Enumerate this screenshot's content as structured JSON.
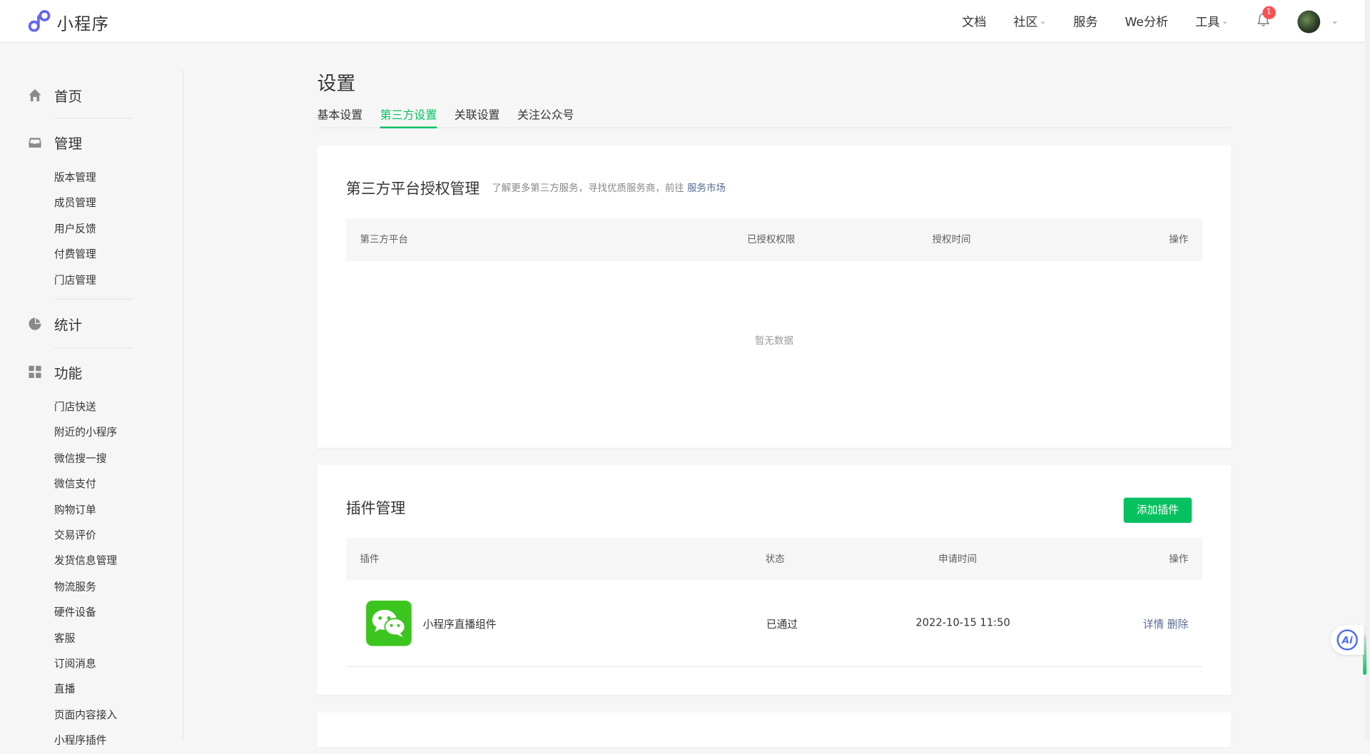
{
  "app": {
    "name": "小程序"
  },
  "topnav": {
    "items": [
      {
        "label": "文档",
        "has_caret": false
      },
      {
        "label": "社区",
        "has_caret": true
      },
      {
        "label": "服务",
        "has_caret": false
      },
      {
        "label": "We分析",
        "has_caret": false
      },
      {
        "label": "工具",
        "has_caret": true
      }
    ],
    "notification_count": "1"
  },
  "sidebar": {
    "home": {
      "label": "首页",
      "icon": "home-icon"
    },
    "manage": {
      "label": "管理",
      "icon": "inbox-icon",
      "items": [
        "版本管理",
        "成员管理",
        "用户反馈",
        "付费管理",
        "门店管理"
      ]
    },
    "stats": {
      "label": "统计",
      "icon": "pie-chart-icon"
    },
    "features": {
      "label": "功能",
      "icon": "grid-icon",
      "items": [
        "门店快送",
        "附近的小程序",
        "微信搜一搜",
        "微信支付",
        "购物订单",
        "交易评价",
        "发货信息管理",
        "物流服务",
        "硬件设备",
        "客服",
        "订阅消息",
        "直播",
        "页面内容接入",
        "小程序插件"
      ]
    }
  },
  "page": {
    "title": "设置",
    "tabs": [
      {
        "label": "基本设置",
        "active": false
      },
      {
        "label": "第三方设置",
        "active": true
      },
      {
        "label": "关联设置",
        "active": false
      },
      {
        "label": "关注公众号",
        "active": false
      }
    ]
  },
  "third_party": {
    "title": "第三方平台授权管理",
    "desc_prefix": "了解更多第三方服务，寻找优质服务商，前往",
    "desc_link": "服务市场",
    "columns": [
      "第三方平台",
      "已授权权限",
      "授权时间",
      "操作"
    ],
    "empty_text": "暂无数据"
  },
  "plugins": {
    "title": "插件管理",
    "add_button": "添加插件",
    "columns": [
      "插件",
      "状态",
      "申请时间",
      "操作"
    ],
    "rows": [
      {
        "name": "小程序直播组件",
        "status": "已通过",
        "time": "2022-10-15 11:50",
        "actions": [
          "详情",
          "删除"
        ],
        "icon": "wechat-icon"
      }
    ]
  },
  "fab": {
    "label": "Ai"
  },
  "colors": {
    "brand_green": "#07c160",
    "link_blue": "#576b95",
    "plugin_icon_green": "#3cc51f",
    "badge_red": "#fa5151"
  }
}
